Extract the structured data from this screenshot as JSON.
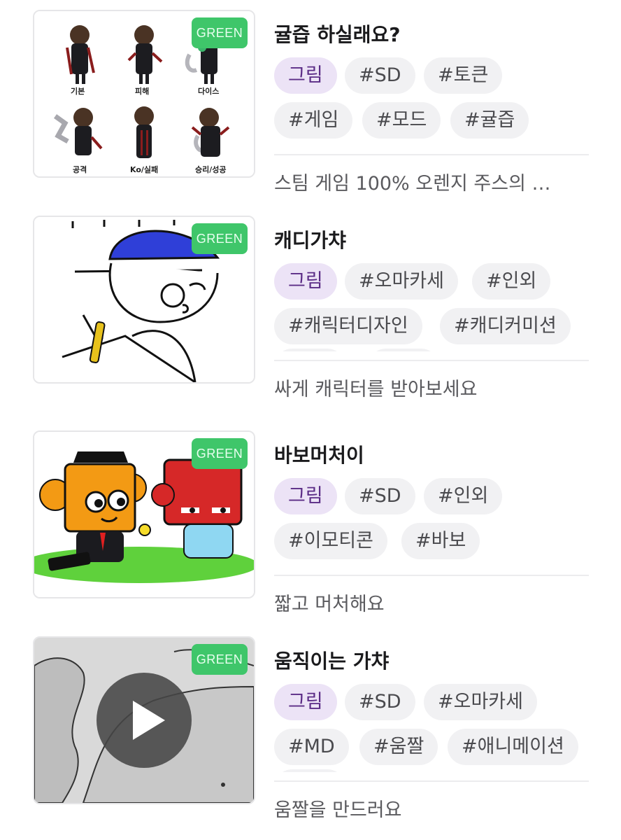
{
  "items": [
    {
      "badge": "GREEN",
      "title": "귤즙 하실래요?",
      "tags": [
        "그림",
        "#SD",
        "#토큰",
        "#게임",
        "#모드",
        "#귤즙"
      ],
      "description": "스팀 게임 100% 오렌지 주스의 …",
      "thumb_labels": [
        "기본",
        "피해",
        "다이스",
        "공격",
        "Ko/실패",
        "승리/성공"
      ]
    },
    {
      "badge": "GREEN",
      "title": "캐디가챠",
      "tags": [
        "그림",
        "#오마카세",
        "#인외",
        "#캐릭터디자인",
        "#캐디커미션"
      ],
      "description": "싸게 캐릭터를 받아보세요"
    },
    {
      "badge": "GREEN",
      "title": "바보머처이",
      "tags": [
        "그림",
        "#SD",
        "#인외",
        "#이모티콘",
        "#바보"
      ],
      "description": "짧고 머처해요"
    },
    {
      "badge": "GREEN",
      "title": "움직이는 가챠",
      "tags": [
        "그림",
        "#SD",
        "#오마카세",
        "#MD",
        "#움짤",
        "#애니메이션"
      ],
      "description": "움짤을 만드러요",
      "play_icon": "play-icon"
    }
  ],
  "colors": {
    "badge_green": "#3fc66a",
    "category_tag_bg": "#ece3f6",
    "category_tag_text": "#5b2c86",
    "tag_bg": "#f1f1f3"
  }
}
